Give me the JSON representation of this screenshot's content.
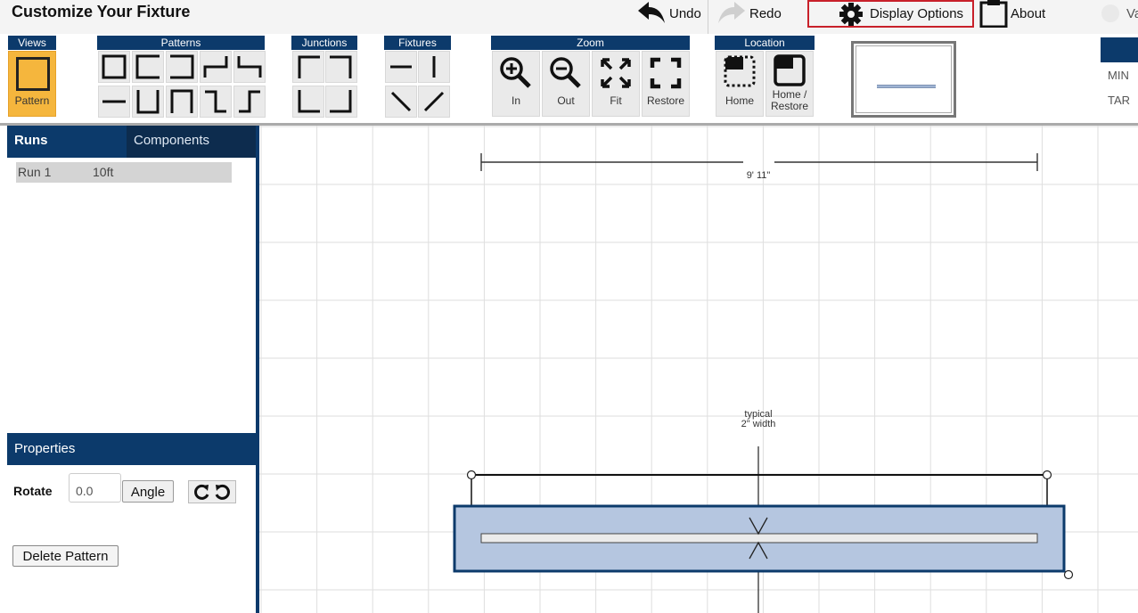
{
  "app": {
    "title": "Customize Your Fixture"
  },
  "topbar": {
    "undo": "Undo",
    "redo": "Redo",
    "display_options": "Display Options",
    "about": "About",
    "cut_label": "Va"
  },
  "groups": {
    "views": "Views",
    "patterns": "Patterns",
    "junctions": "Junctions",
    "fixtures": "Fixtures",
    "zoom": "Zoom",
    "location": "Location"
  },
  "views": {
    "pattern_label": "Pattern"
  },
  "zoom": {
    "in": "In",
    "out": "Out",
    "fit": "Fit",
    "restore": "Restore"
  },
  "location": {
    "home": "Home",
    "home_restore_1": "Home /",
    "home_restore_2": "Restore"
  },
  "right_panel": {
    "min_label": "MIN",
    "tar_label": "TAR"
  },
  "left_panel": {
    "tab_runs": "Runs",
    "tab_components": "Components",
    "runs": [
      {
        "name": "Run 1",
        "length": "10ft"
      }
    ],
    "properties_title": "Properties",
    "rotate_label": "Rotate",
    "rotate_value": "0.0",
    "angle_button": "Angle",
    "delete_button": "Delete Pattern"
  },
  "canvas": {
    "overall_dimension": "9' 11\"",
    "width_note_1": "typical",
    "width_note_2": "2\" width"
  },
  "colors": {
    "header_navy": "#0c3a6b",
    "active_view": "#f5b63d",
    "fixture_fill": "#b5c6e0",
    "highlight_red": "#c8202a"
  }
}
